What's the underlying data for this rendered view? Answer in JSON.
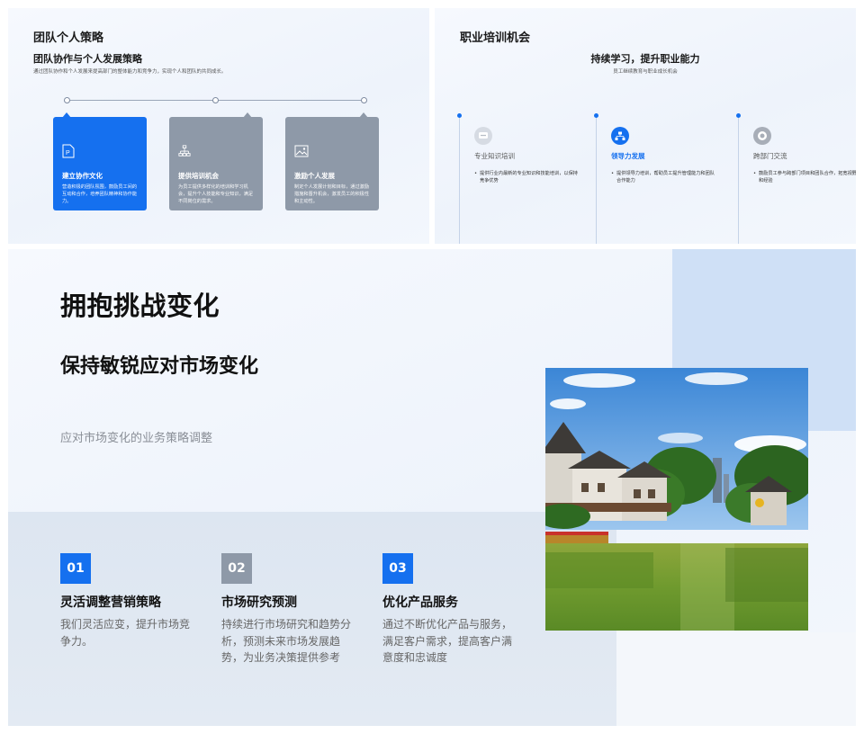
{
  "slide1": {
    "title": "团队个人策略",
    "subtitle": "团队协作与个人发展策略",
    "description": "通过团队协作和个人发展来提高部门的整体能力和竞争力，实现个人和团队的共同成长。",
    "cards": [
      {
        "icon": "document-p-icon",
        "title": "建立协作文化",
        "text": "营造积极的团队氛围，鼓励员工间的互动和合作，培养团队精神和协作能力。",
        "color": "#1570ef"
      },
      {
        "icon": "org-chart-icon",
        "title": "提供培训机会",
        "text": "为员工提供多样化的培训和学习机会，提升个人技能和专业知识，满足不同岗位的需求。",
        "color": "#8e99a8"
      },
      {
        "icon": "image-icon",
        "title": "激励个人发展",
        "text": "制定个人发展计划和目标，通过激励措施和晋升机会，激发员工的积极性和主动性。",
        "color": "#8e99a8"
      }
    ]
  },
  "slide2": {
    "title": "职业培训机会",
    "heading": "持续学习，提升职业能力",
    "sub": "员工继续教育与职业成长机会",
    "columns": [
      {
        "icon": "chat-icon",
        "title": "专业知识培训",
        "text": "提供行业内最新的专业知识和技能培训，以保持竞争优势",
        "active": false
      },
      {
        "icon": "hierarchy-icon",
        "title": "领导力发展",
        "text": "提供领导力培训，帮助员工提升管理能力和团队合作能力",
        "active": true
      },
      {
        "icon": "target-icon",
        "title": "跨部门交流",
        "text": "鼓励员工参与跨部门项目和团队合作，拓宽视野和经验",
        "active": false
      }
    ]
  },
  "slide3": {
    "title": "拥抱挑战变化",
    "subtitle": "保持敏锐应对市场变化",
    "lead": "应对市场变化的业务策略调整",
    "items": [
      {
        "num": "01",
        "title": "灵活调整营销策略",
        "text": "我们灵活应变，提升市场竞争力。",
        "color": "#1570ef"
      },
      {
        "num": "02",
        "title": "市场研究预测",
        "text": "持续进行市场研究和趋势分析，预测未来市场发展趋势，为业务决策提供参考",
        "color": "#8e99a8"
      },
      {
        "num": "03",
        "title": "优化产品服务",
        "text": "通过不断优化产品与服务，满足客户需求，提高客户满意度和忠诚度",
        "color": "#1570ef"
      }
    ]
  },
  "colors": {
    "accent": "#1570ef",
    "muted": "#8e99a8",
    "text": "#111111"
  }
}
